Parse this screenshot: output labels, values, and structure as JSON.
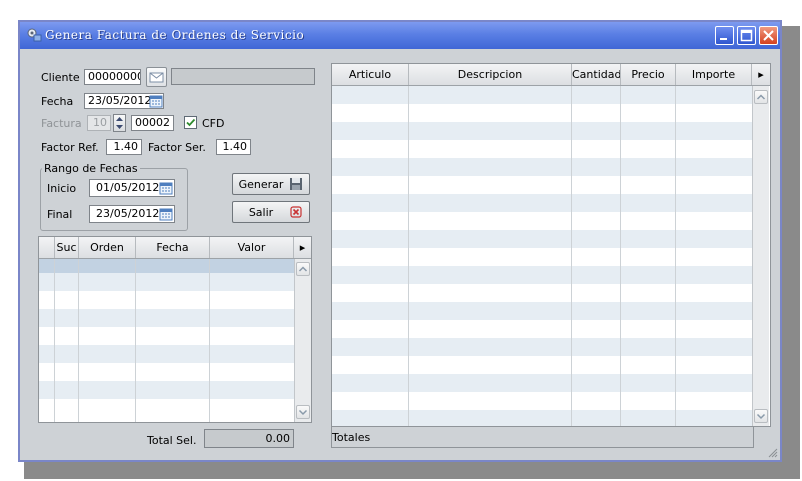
{
  "window": {
    "title": "Genera Factura de Ordenes de Servicio"
  },
  "form": {
    "cliente_label": "Cliente",
    "cliente_code": "00000000",
    "cliente_name": "",
    "fecha_label": "Fecha",
    "fecha_value": "23/05/2012",
    "factura_label": "Factura",
    "factura_serie": "10",
    "factura_numero": "00002",
    "cfd_label": "CFD",
    "cfd_checked": true,
    "factor_ref_label": "Factor Ref.",
    "factor_ref_value": "1.40",
    "factor_ser_label": "Factor Ser.",
    "factor_ser_value": "1.40"
  },
  "rango": {
    "title": "Rango de Fechas",
    "inicio_label": "Inicio",
    "inicio_value": "01/05/2012",
    "final_label": "Final",
    "final_value": "23/05/2012"
  },
  "buttons": {
    "generar": "Generar",
    "salir": "Salir"
  },
  "orders_table": {
    "columns": [
      "",
      "Suc",
      "Orden",
      "Fecha",
      "Valor"
    ],
    "more_arrow": "▸"
  },
  "total_sel": {
    "label": "Total Sel.",
    "value": "0.00"
  },
  "items_table": {
    "columns": [
      "Articulo",
      "Descripcion",
      "Cantidad",
      "Precio",
      "Importe"
    ],
    "more_arrow": "▸"
  },
  "totales_label": "Totales",
  "colors": {
    "titlebar": "#4a70dc",
    "window_bg": "#ced2d6",
    "row_alt": "#e6edf3",
    "row_selected": "#c2d2e2"
  }
}
